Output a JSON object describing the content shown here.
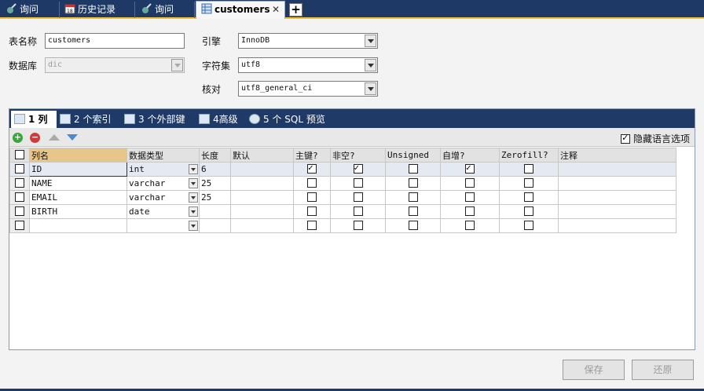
{
  "tabs": [
    {
      "label": "询问"
    },
    {
      "label": "历史记录"
    },
    {
      "label": "询问"
    },
    {
      "label": "customers"
    }
  ],
  "form": {
    "table_name_label": "表名称",
    "table_name_value": "customers",
    "database_label": "数据库",
    "database_value": "dic",
    "engine_label": "引擎",
    "engine_value": "InnoDB",
    "charset_label": "字符集",
    "charset_value": "utf8",
    "collation_label": "核对",
    "collation_value": "utf8_general_ci"
  },
  "subtabs": [
    {
      "label": "1 列"
    },
    {
      "label": "2 个索引"
    },
    {
      "label": "3 个外部键"
    },
    {
      "label": "4高级"
    },
    {
      "label": "5 个 SQL 预览"
    }
  ],
  "toolbar": {
    "hide_lang_label": "隐藏语言选项"
  },
  "columns_header": [
    "列名",
    "数据类型",
    "长度",
    "默认",
    "主键?",
    "非空?",
    "Unsigned",
    "自增?",
    "Zerofill?",
    "注释"
  ],
  "rows": [
    {
      "name": "ID",
      "type": "int",
      "length": "6",
      "default": "",
      "pk": true,
      "notnull": true,
      "unsigned": false,
      "autoinc": true,
      "zerofill": false,
      "comment": ""
    },
    {
      "name": "NAME",
      "type": "varchar",
      "length": "25",
      "default": "",
      "pk": false,
      "notnull": false,
      "unsigned": false,
      "autoinc": false,
      "zerofill": false,
      "comment": ""
    },
    {
      "name": "EMAIL",
      "type": "varchar",
      "length": "25",
      "default": "",
      "pk": false,
      "notnull": false,
      "unsigned": false,
      "autoinc": false,
      "zerofill": false,
      "comment": ""
    },
    {
      "name": "BIRTH",
      "type": "date",
      "length": "",
      "default": "",
      "pk": false,
      "notnull": false,
      "unsigned": false,
      "autoinc": false,
      "zerofill": false,
      "comment": ""
    },
    {
      "name": "",
      "type": "",
      "length": "",
      "default": "",
      "pk": false,
      "notnull": false,
      "unsigned": false,
      "autoinc": false,
      "zerofill": false,
      "comment": ""
    }
  ],
  "buttons": {
    "save": "保存",
    "revert": "还原"
  }
}
